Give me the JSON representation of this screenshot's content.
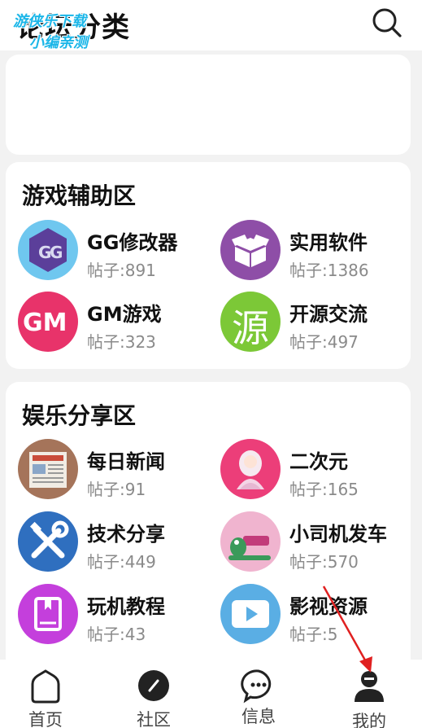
{
  "header": {
    "title": "论坛分类",
    "watermark_line1": "游侠乐下载",
    "watermark_line2": "小编亲测"
  },
  "sections": [
    {
      "title": "游戏辅助区",
      "items": [
        {
          "name": "GG修改器",
          "count": "帖子:891",
          "icon": "gg-modifier-icon"
        },
        {
          "name": "实用软件",
          "count": "帖子:1386",
          "icon": "box-icon"
        },
        {
          "name": "GM游戏",
          "count": "帖子:323",
          "icon": "gm-icon"
        },
        {
          "name": "开源交流",
          "count": "帖子:497",
          "icon": "source-char-icon",
          "icon_text": "源"
        }
      ]
    },
    {
      "title": "娱乐分享区",
      "items": [
        {
          "name": "每日新闻",
          "count": "帖子:91",
          "icon": "newspaper-icon"
        },
        {
          "name": "二次元",
          "count": "帖子:165",
          "icon": "anime-girl-icon"
        },
        {
          "name": "技术分享",
          "count": "帖子:449",
          "icon": "tools-icon"
        },
        {
          "name": "小司机发车",
          "count": "帖子:570",
          "icon": "driver-icon"
        },
        {
          "name": "玩机教程",
          "count": "帖子:43",
          "icon": "book-icon"
        },
        {
          "name": "影视资源",
          "count": "帖子:5",
          "icon": "play-icon"
        }
      ]
    }
  ],
  "tabbar": {
    "items": [
      {
        "label": "首页",
        "icon": "home-icon"
      },
      {
        "label": "社区",
        "icon": "compass-icon"
      },
      {
        "label": "信息",
        "icon": "chat-icon"
      },
      {
        "label": "我的",
        "icon": "user-icon"
      }
    ],
    "active_index": 3
  },
  "colors": {
    "background": "#f2f2f2",
    "card": "#ffffff",
    "title": "#111111",
    "count": "#8a8a8a",
    "watermark": "#1bb6e8",
    "annotation_arrow": "#e02020"
  }
}
